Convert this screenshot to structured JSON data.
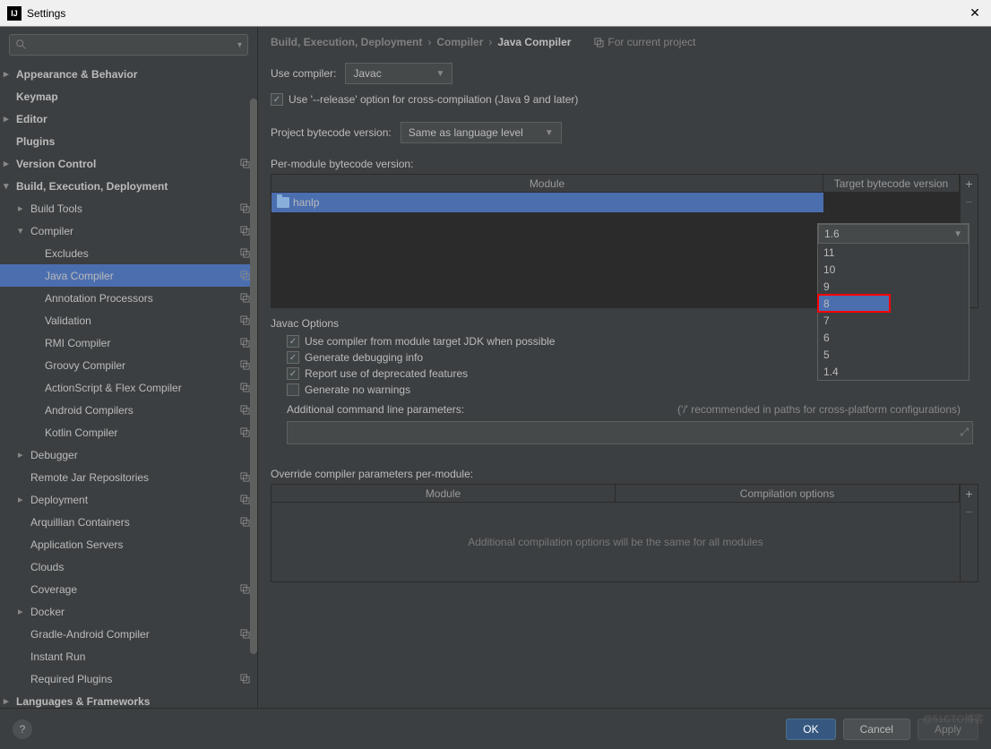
{
  "window": {
    "title": "Settings"
  },
  "search": {
    "placeholder": ""
  },
  "sidebar": {
    "items": [
      {
        "label": "Appearance & Behavior",
        "lvl": 0,
        "chev": "collapsed",
        "ind": false
      },
      {
        "label": "Keymap",
        "lvl": 0,
        "chev": "",
        "ind": false
      },
      {
        "label": "Editor",
        "lvl": 0,
        "chev": "collapsed",
        "ind": false
      },
      {
        "label": "Plugins",
        "lvl": 0,
        "chev": "",
        "ind": false
      },
      {
        "label": "Version Control",
        "lvl": 0,
        "chev": "collapsed",
        "ind": true
      },
      {
        "label": "Build, Execution, Deployment",
        "lvl": 0,
        "chev": "expanded",
        "ind": false
      },
      {
        "label": "Build Tools",
        "lvl": 1,
        "chev": "collapsed",
        "ind": true
      },
      {
        "label": "Compiler",
        "lvl": 1,
        "chev": "expanded",
        "ind": true
      },
      {
        "label": "Excludes",
        "lvl": 2,
        "chev": "",
        "ind": true
      },
      {
        "label": "Java Compiler",
        "lvl": 2,
        "chev": "",
        "ind": true,
        "selected": true
      },
      {
        "label": "Annotation Processors",
        "lvl": 2,
        "chev": "",
        "ind": true
      },
      {
        "label": "Validation",
        "lvl": 2,
        "chev": "",
        "ind": true
      },
      {
        "label": "RMI Compiler",
        "lvl": 2,
        "chev": "",
        "ind": true
      },
      {
        "label": "Groovy Compiler",
        "lvl": 2,
        "chev": "",
        "ind": true
      },
      {
        "label": "ActionScript & Flex Compiler",
        "lvl": 2,
        "chev": "",
        "ind": true
      },
      {
        "label": "Android Compilers",
        "lvl": 2,
        "chev": "",
        "ind": true
      },
      {
        "label": "Kotlin Compiler",
        "lvl": 2,
        "chev": "",
        "ind": true
      },
      {
        "label": "Debugger",
        "lvl": 1,
        "chev": "collapsed",
        "ind": false
      },
      {
        "label": "Remote Jar Repositories",
        "lvl": 1,
        "chev": "",
        "ind": true
      },
      {
        "label": "Deployment",
        "lvl": 1,
        "chev": "collapsed",
        "ind": true
      },
      {
        "label": "Arquillian Containers",
        "lvl": 1,
        "chev": "",
        "ind": true
      },
      {
        "label": "Application Servers",
        "lvl": 1,
        "chev": "",
        "ind": false
      },
      {
        "label": "Clouds",
        "lvl": 1,
        "chev": "",
        "ind": false
      },
      {
        "label": "Coverage",
        "lvl": 1,
        "chev": "",
        "ind": true
      },
      {
        "label": "Docker",
        "lvl": 1,
        "chev": "collapsed",
        "ind": false
      },
      {
        "label": "Gradle-Android Compiler",
        "lvl": 1,
        "chev": "",
        "ind": true
      },
      {
        "label": "Instant Run",
        "lvl": 1,
        "chev": "",
        "ind": false
      },
      {
        "label": "Required Plugins",
        "lvl": 1,
        "chev": "",
        "ind": true
      },
      {
        "label": "Languages & Frameworks",
        "lvl": 0,
        "chev": "collapsed",
        "ind": false
      }
    ]
  },
  "breadcrumb": {
    "parts": [
      "Build, Execution, Deployment",
      "Compiler",
      "Java Compiler"
    ],
    "badge": "For current project"
  },
  "form": {
    "use_compiler_label": "Use compiler:",
    "use_compiler_value": "Javac",
    "release_checkbox_label": "Use '--release' option for cross-compilation (Java 9 and later)",
    "release_checked": true,
    "project_bytecode_label": "Project bytecode version:",
    "project_bytecode_value": "Same as language level",
    "per_module_label": "Per-module bytecode version:",
    "module_header": "Module",
    "target_header": "Target bytecode version",
    "module_row": {
      "name": "hanlp",
      "version": "1.6"
    },
    "version_options": [
      "11",
      "10",
      "9",
      "8",
      "7",
      "6",
      "5",
      "1.4"
    ],
    "version_highlight": "8",
    "javac_title": "Javac Options",
    "javac_opts": [
      {
        "label": "Use compiler from module target JDK when possible",
        "checked": true
      },
      {
        "label": "Generate debugging info",
        "checked": true
      },
      {
        "label": "Report use of deprecated features",
        "checked": true
      },
      {
        "label": "Generate no warnings",
        "checked": false
      }
    ],
    "cmdline_label": "Additional command line parameters:",
    "cmdline_hint": "('/' recommended in paths for cross-platform configurations)",
    "override_label": "Override compiler parameters per-module:",
    "override_head_module": "Module",
    "override_head_opts": "Compilation options",
    "override_empty": "Additional compilation options will be the same for all modules"
  },
  "footer": {
    "ok": "OK",
    "cancel": "Cancel",
    "apply": "Apply"
  },
  "watermark": "@51CTO博客"
}
